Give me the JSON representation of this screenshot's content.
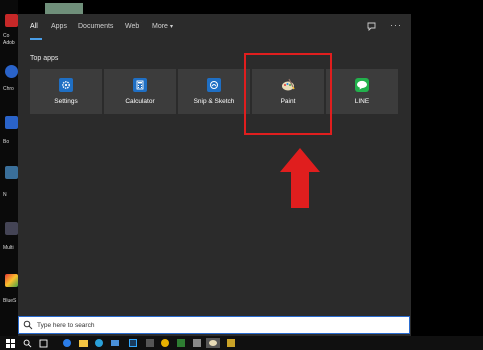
{
  "tabs": [
    "All",
    "Apps",
    "Documents",
    "Web",
    "More"
  ],
  "more_caret": "▾",
  "ellipsis": "···",
  "section_title": "Top apps",
  "top_apps": [
    {
      "label": "Settings",
      "icon": "gear-icon",
      "color": "#1f6fc4"
    },
    {
      "label": "Calculator",
      "icon": "calculator-icon",
      "color": "#1f6fc4"
    },
    {
      "label": "Snip & Sketch",
      "icon": "snip-sketch-icon",
      "color": "#1f6fc4"
    },
    {
      "label": "Paint",
      "icon": "paint-palette-icon",
      "color": "#d8c9a0"
    },
    {
      "label": "LINE",
      "icon": "line-icon",
      "color": "#22b14c"
    }
  ],
  "search": {
    "placeholder": "Type here to search"
  },
  "desktop_labels": [
    "Co",
    "Adob",
    "Chro",
    "Bo",
    "N",
    "Multi",
    "BlueS"
  ],
  "highlight_color": "#e01e1e"
}
